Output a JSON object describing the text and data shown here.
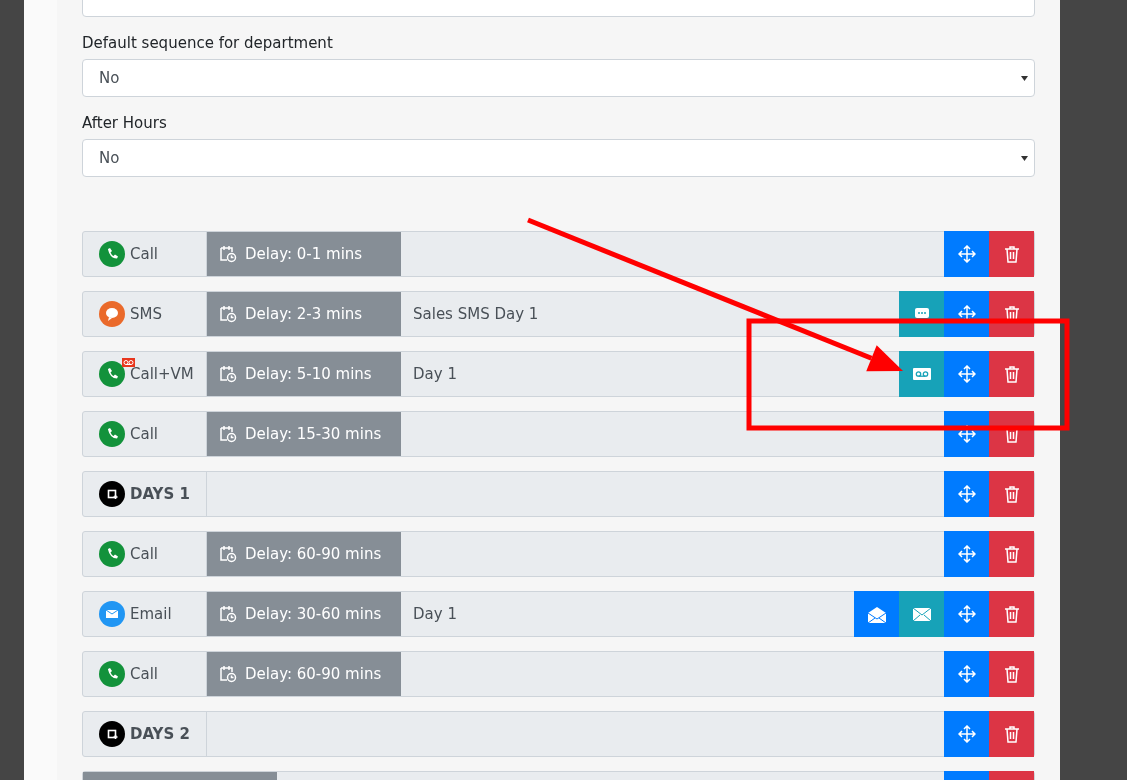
{
  "fields": [
    {
      "label": "Default sequence for department",
      "value": "No"
    },
    {
      "label": "After Hours",
      "value": "No"
    }
  ],
  "steps": [
    {
      "kind": "call",
      "label": "Call",
      "delay": "Delay: 0-1 mins",
      "buttons": [
        {
          "kind": "move"
        },
        {
          "kind": "delete"
        }
      ]
    },
    {
      "kind": "sms",
      "label": "SMS",
      "delay": "Delay: 2-3 mins",
      "content": "Sales SMS Day 1",
      "buttons": [
        {
          "kind": "sms"
        },
        {
          "kind": "move"
        },
        {
          "kind": "delete"
        }
      ]
    },
    {
      "kind": "callvm",
      "label": "Call+VM",
      "delay": "Delay: 5-10 mins",
      "content": "Day 1",
      "buttons": [
        {
          "kind": "voicemail"
        },
        {
          "kind": "move"
        },
        {
          "kind": "delete"
        }
      ]
    },
    {
      "kind": "call",
      "label": "Call",
      "delay": "Delay: 15-30 mins",
      "buttons": [
        {
          "kind": "move"
        },
        {
          "kind": "delete"
        }
      ]
    },
    {
      "kind": "day",
      "label": "DAYS 1",
      "buttons": [
        {
          "kind": "move"
        },
        {
          "kind": "delete"
        }
      ]
    },
    {
      "kind": "call",
      "label": "Call",
      "delay": "Delay: 60-90 mins",
      "buttons": [
        {
          "kind": "move"
        },
        {
          "kind": "delete"
        }
      ]
    },
    {
      "kind": "email",
      "label": "Email",
      "delay": "Delay: 30-60 mins",
      "content": "Day 1",
      "buttons": [
        {
          "kind": "email-open"
        },
        {
          "kind": "email"
        },
        {
          "kind": "move"
        },
        {
          "kind": "delete"
        }
      ]
    },
    {
      "kind": "call",
      "label": "Call",
      "delay": "Delay: 60-90 mins",
      "buttons": [
        {
          "kind": "move"
        },
        {
          "kind": "delete"
        }
      ]
    },
    {
      "kind": "day",
      "label": "DAYS 2",
      "buttons": [
        {
          "kind": "move"
        },
        {
          "kind": "delete"
        }
      ]
    },
    {
      "kind": "partial",
      "buttons": [
        {
          "kind": "move"
        },
        {
          "kind": "delete"
        }
      ]
    }
  ],
  "annotations": [
    {
      "kind": "arrow"
    },
    {
      "kind": "rectangle"
    }
  ]
}
